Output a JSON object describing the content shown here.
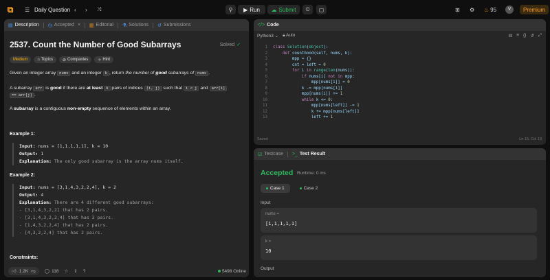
{
  "topbar": {
    "title": "Daily Question",
    "run": "Run",
    "submit": "Submit",
    "streak": "95",
    "avatar": "V",
    "premium": "Premium"
  },
  "left": {
    "tabs": [
      "Description",
      "Accepted",
      "Editorial",
      "Solutions",
      "Submissions"
    ],
    "title": "2537. Count the Number of Good Subarrays",
    "solved": "Solved",
    "tags": [
      "Medium",
      "Topics",
      "Companies",
      "Hint"
    ],
    "p1": {
      "a": "Given an integer array ",
      "b": "nums",
      "c": " and an integer ",
      "d": "k",
      "e": ", return ",
      "f": "the number of ",
      "g": "good",
      "h": " subarrays of ",
      "i": "nums",
      "j": "."
    },
    "p2": {
      "a": "A subarray ",
      "b": "arr",
      "c": " is ",
      "d": "good",
      "e": " if there are ",
      "f": "at least ",
      "g": "k",
      "h": " pairs of indices ",
      "i": "(i, j)",
      "j": " such that ",
      "k": "i < j",
      "l": " and ",
      "m": "arr[i]",
      "n": "== arr[j]",
      "o": "."
    },
    "p3": {
      "a": "A ",
      "b": "subarray",
      "c": " is a contiguous ",
      "d": "non-empty",
      "e": " sequence of elements within an array."
    },
    "example1": {
      "heading": "Example 1:",
      "input_label": "Input:",
      "input": " nums = [1,1,1,1,1], k = 10",
      "output_label": "Output:",
      "output": " 1",
      "explanation_label": "Explanation:",
      "explanation": " The only good subarray is the array nums itself."
    },
    "example2": {
      "heading": "Example 2:",
      "input_label": "Input:",
      "input": " nums = [3,1,4,3,2,2,4], k = 2",
      "output_label": "Output:",
      "output": " 4",
      "explanation_label": "Explanation:",
      "explanation": " There are 4 different good subarrays:",
      "items": [
        "- [3,1,4,3,2,2] that has 2 pairs.",
        "- [3,1,4,3,2,2,4] that has 3 pairs.",
        "- [1,4,3,2,2,4] that has 2 pairs.",
        "- [4,3,2,2,4] that has 2 pairs."
      ]
    },
    "constraints": "Constraints:",
    "likes": "1.2K",
    "comments": "118",
    "online": "5498 Online"
  },
  "code": {
    "tab": "Code",
    "language": "Python3",
    "auto": "Auto",
    "lines": [
      "class Solution(object):",
      "    def countGood(self, nums, k):",
      "        mpp = {}",
      "        cnt = left = 0",
      "        for i in range(len(nums)):",
      "            if nums[i] not in mpp:",
      "                mpp[nums[i]] = 0",
      "            k -= mpp[nums[i]]",
      "            mpp[nums[i]] += 1",
      "            while k <= 0:",
      "                mpp[nums[left]] -= 1",
      "                k += mpp[nums[left]]",
      "                left += 1"
    ],
    "saved": "Saved",
    "cursor": "Ln 15, Col 19"
  },
  "result": {
    "tabs": [
      "Testcase",
      "Test Result"
    ],
    "status": "Accepted",
    "runtime": "Runtime: 0 ms",
    "cases": [
      "Case 1",
      "Case 2"
    ],
    "input_label": "Input",
    "vars": [
      {
        "name": "nums =",
        "value": "[1,1,1,1,1]"
      },
      {
        "name": "k =",
        "value": "10"
      }
    ],
    "output_label": "Output"
  }
}
